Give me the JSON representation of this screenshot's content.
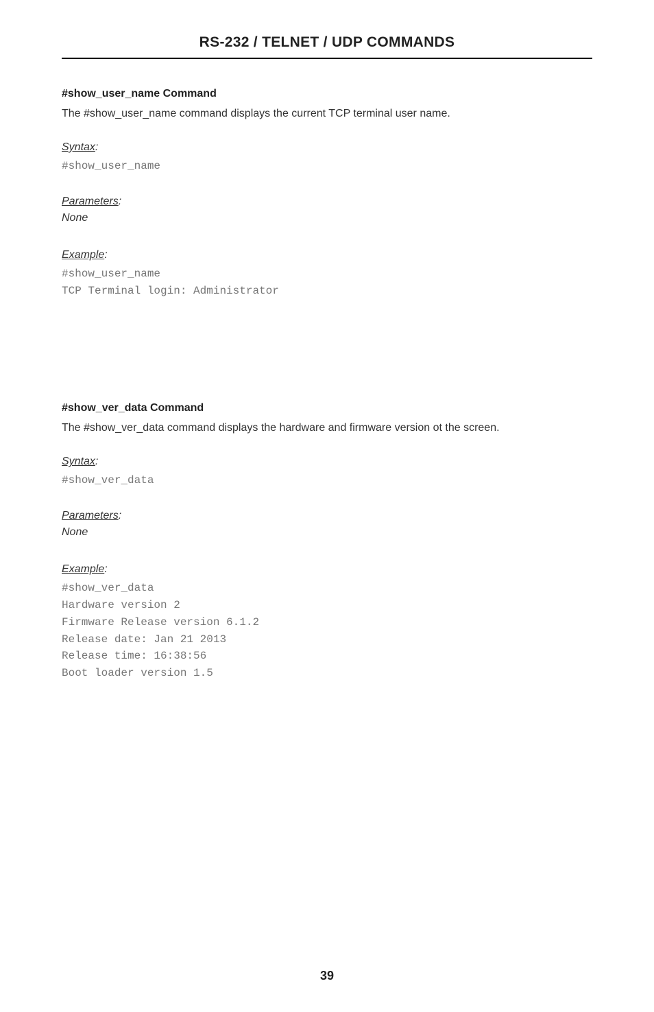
{
  "header": {
    "title": "RS-232 / TELNET / UDP COMMANDS"
  },
  "cmd1": {
    "title": "#show_user_name Command",
    "desc": "The #show_user_name command displays the current TCP terminal user name.",
    "syntax_label": "Syntax",
    "syntax_code": "#show_user_name",
    "params_label": "Parameters",
    "params_value": "None",
    "example_label": "Example",
    "example_code": "#show_user_name\nTCP Terminal login: Administrator"
  },
  "cmd2": {
    "title": "#show_ver_data Command",
    "desc": "The #show_ver_data command displays the hardware and firmware version ot the screen.",
    "syntax_label": "Syntax",
    "syntax_code": "#show_ver_data",
    "params_label": "Parameters",
    "params_value": "None",
    "example_label": "Example",
    "example_code": "#show_ver_data\nHardware version 2\nFirmware Release version 6.1.2\nRelease date: Jan 21 2013\nRelease time: 16:38:56\nBoot loader version 1.5"
  },
  "page_number": "39"
}
